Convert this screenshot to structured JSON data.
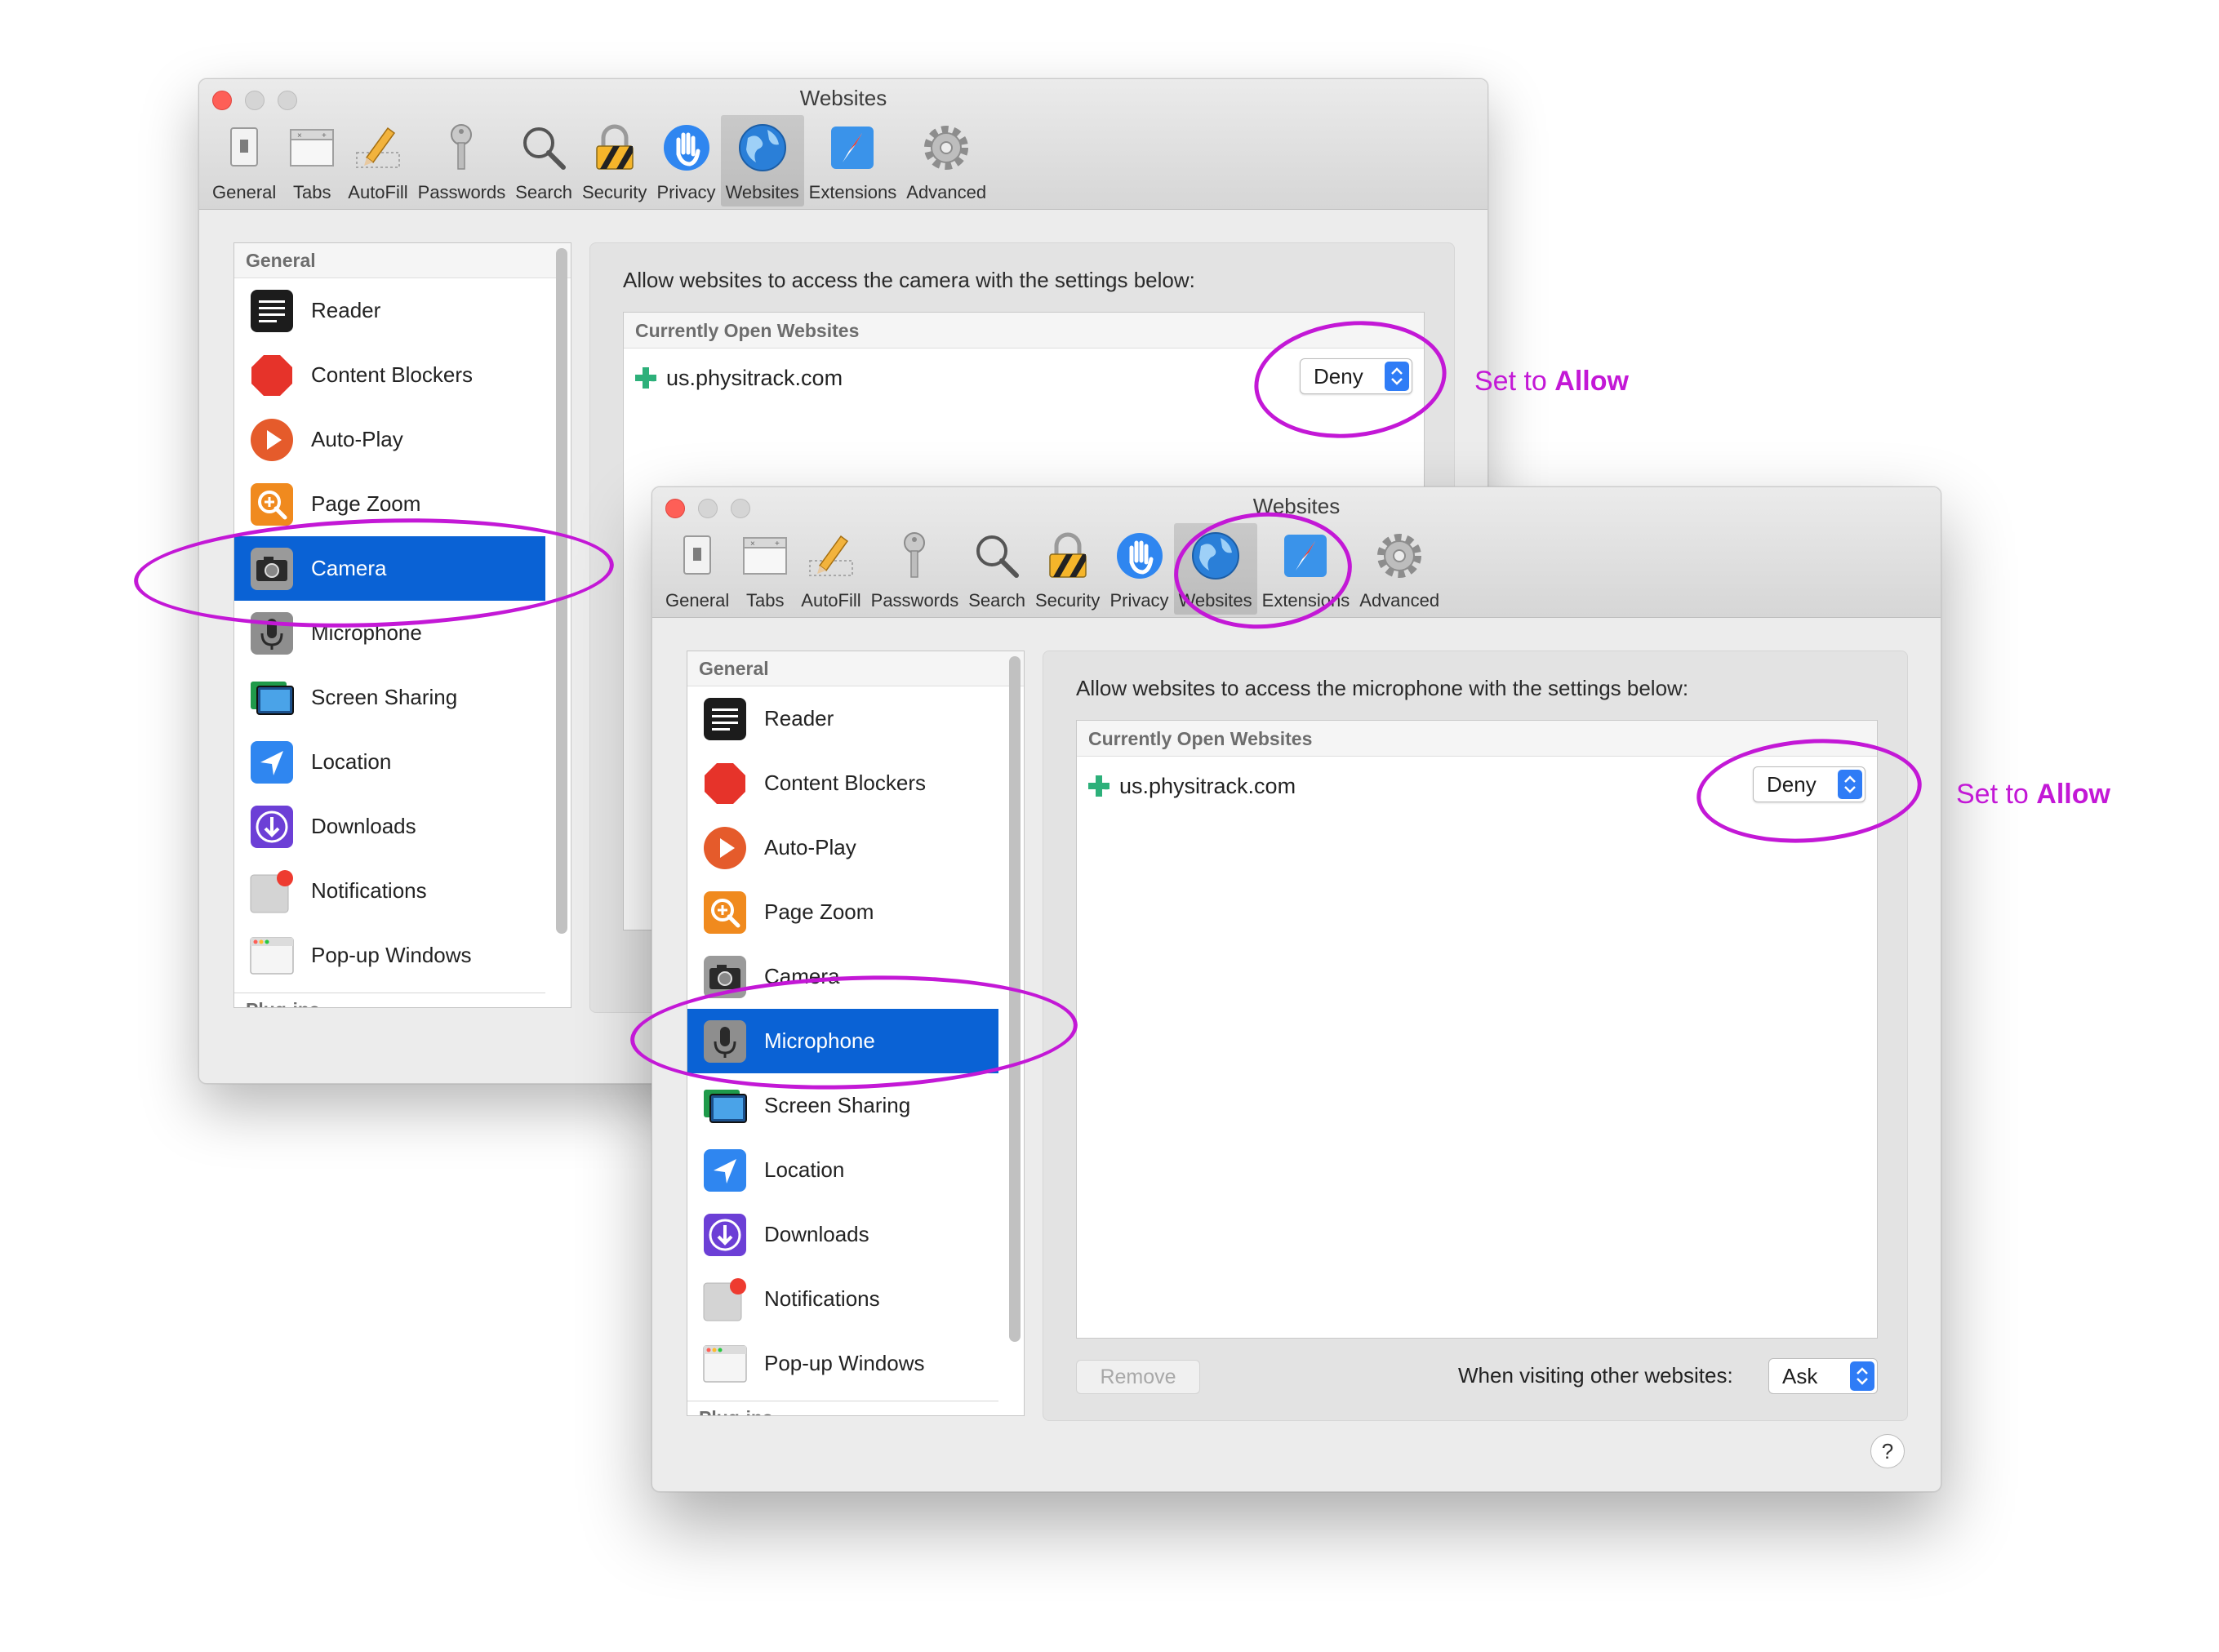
{
  "window_title": "Websites",
  "toolbar": [
    "General",
    "Tabs",
    "AutoFill",
    "Passwords",
    "Search",
    "Security",
    "Privacy",
    "Websites",
    "Extensions",
    "Advanced"
  ],
  "sidebar": {
    "header": "General",
    "items": [
      "Reader",
      "Content Blockers",
      "Auto-Play",
      "Page Zoom",
      "Camera",
      "Microphone",
      "Screen Sharing",
      "Location",
      "Downloads",
      "Notifications",
      "Pop-up Windows"
    ],
    "footer": "Plug-ins"
  },
  "camera_window": {
    "selected": "Camera",
    "description": "Allow websites to access the camera with the settings below:"
  },
  "microphone_window": {
    "selected": "Microphone",
    "description": "Allow websites to access the microphone with the settings below:"
  },
  "sites": {
    "header": "Currently Open Websites",
    "site": "us.physitrack.com",
    "permission": "Deny"
  },
  "footer": {
    "remove_label": "Remove",
    "visiting_label": "When visiting other websites:",
    "visiting_value": "Ask",
    "help_label": "?"
  },
  "annotations": {
    "prefix": "Set to",
    "emphasis": "Allow",
    "color": "#c318d6"
  },
  "colors": {
    "selection": "#0a62d5",
    "close_light": "#fe5f57",
    "stepper": "#2f7cf6"
  }
}
